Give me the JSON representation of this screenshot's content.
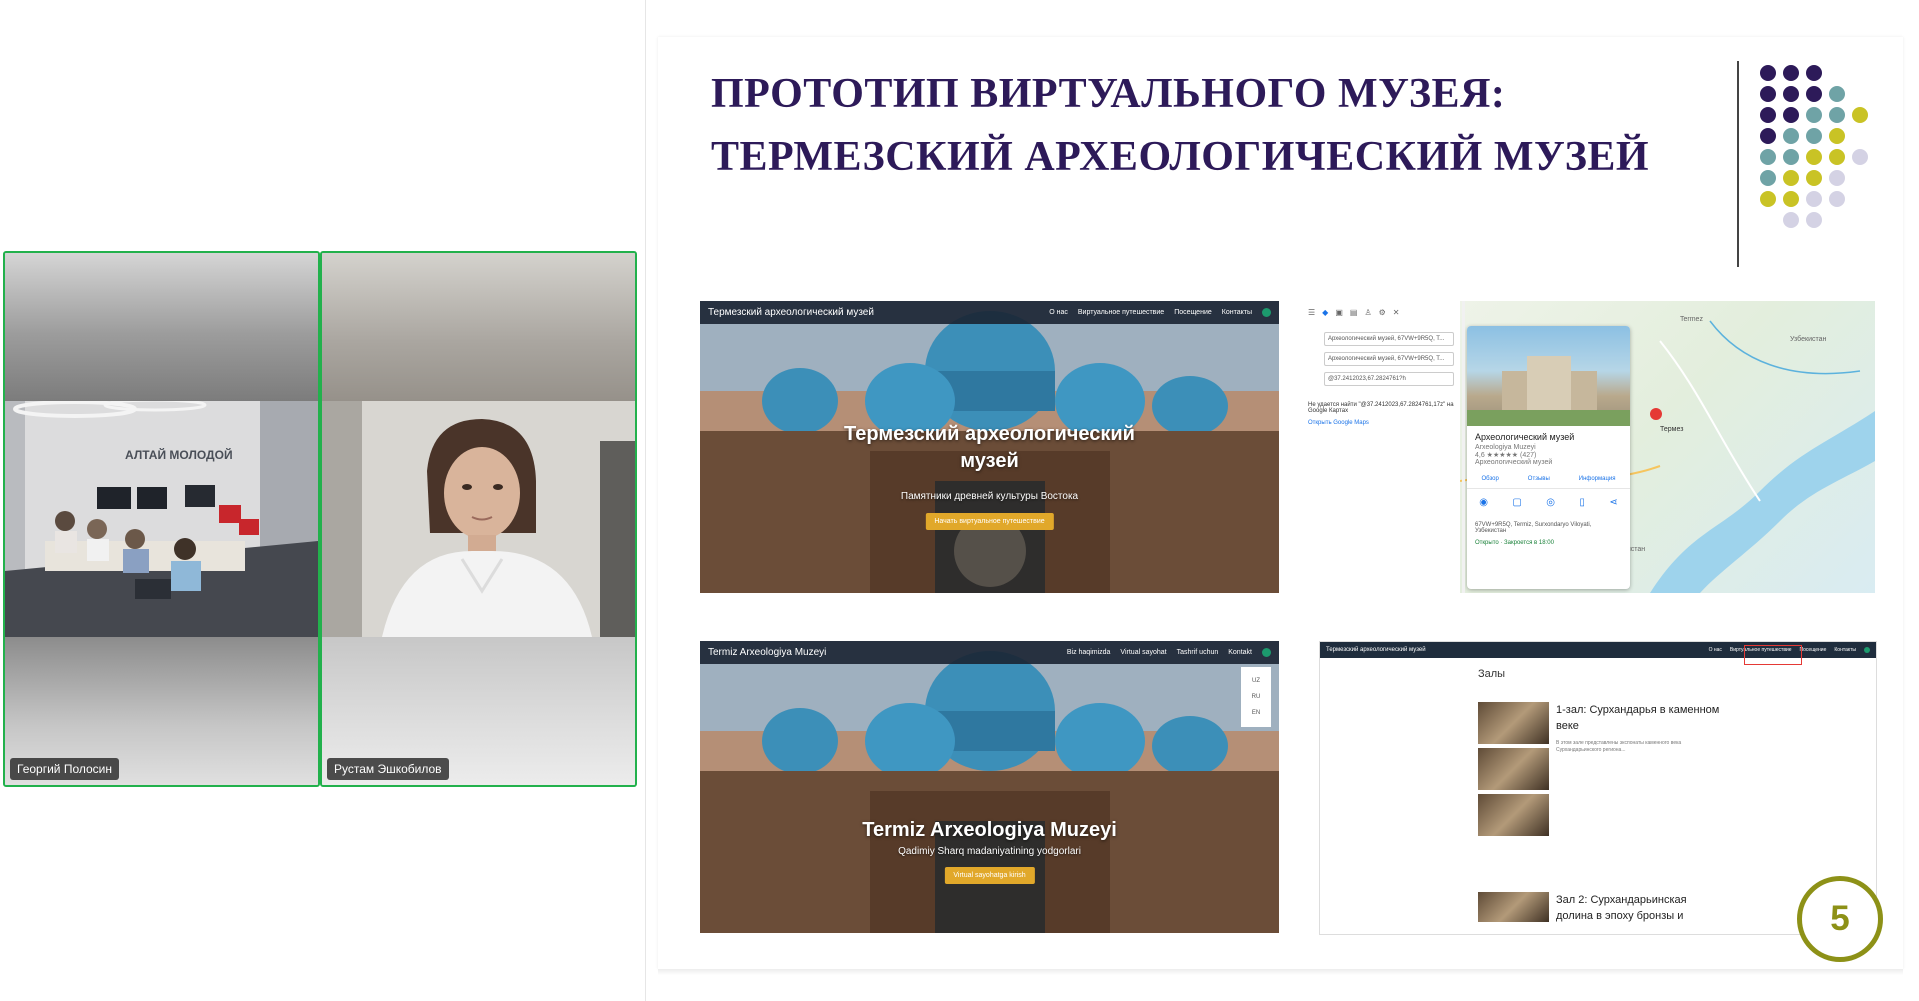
{
  "participants": [
    {
      "name": "Георгий Полосин",
      "video_wall_text": "АЛТАЙ МОЛОДОЙ"
    },
    {
      "name": "Рустам Эшкобилов"
    }
  ],
  "slide": {
    "title_line1": "ПРОТОТИП ВИРТУАЛЬНОГО МУЗЕЯ:",
    "title_line2": "ТЕРМЕЗСКИЙ АРХЕОЛОГИЧЕСКИЙ МУЗЕЙ",
    "page_number": "5",
    "accent_colors": {
      "purple": "#2d1a59",
      "teal": "#6fa3a6",
      "yellow": "#c9c325",
      "lavender": "#d4d2e4",
      "olive": "#8d9117"
    },
    "screenshot_ru": {
      "nav_title": "Термезский археологический музей",
      "nav_links": [
        "О нас",
        "Виртуальное путешествие",
        "Посещение",
        "Контакты"
      ],
      "hero_title_line1": "Термезский археологический",
      "hero_title_line2": "музей",
      "hero_subtitle": "Памятники древней культуры Востока",
      "hero_button": "Начать виртуальное путешествие"
    },
    "screenshot_uz": {
      "nav_title": "Termiz Arxeologiya Muzeyi",
      "nav_links": [
        "Biz haqimizda",
        "Virtual sayohat",
        "Tashrif uchun",
        "Kontakt"
      ],
      "lang_options": [
        "UZ",
        "RU",
        "EN"
      ],
      "hero_title": "Termiz Arxeologiya Muzeyi",
      "hero_subtitle": "Qadimiy Sharq madaniyatining yodgorlari",
      "hero_button": "Virtual sayohatga kirish"
    },
    "screenshot_map": {
      "search_rows": [
        "Археологический музей, 67VW+9R5Q, T...",
        "Археологический музей, 67VW+9R5Q, T...",
        "@37.2412023,67.2824761?h"
      ],
      "notice": "Не удается найти \"@37.2412023,67.2824761,17z\" на Google Картах",
      "link": "Открыть Google Maps",
      "card_title": "Археологический музей",
      "card_subtitle": "Arxeologiya Muzeyi",
      "card_rating": "4,6 ★★★★★ (427)",
      "card_category": "Археологический музей",
      "card_tabs": [
        "Обзор",
        "Отзывы",
        "Информация"
      ],
      "card_address": "67VW+9R5Q, Termiz, Surxondaryo Viloyati, Узбекистан",
      "card_hours": "Открыто · Закроется в 18:00",
      "map_labels": [
        "Termez",
        "Туркменистан",
        "Термез",
        "Узбекистан"
      ]
    },
    "screenshot_halls": {
      "nav_title": "Термезский археологический музей",
      "nav_links": [
        "О нас",
        "Виртуальное путешествие",
        "Посещение",
        "Контакты"
      ],
      "section_title": "Залы",
      "hall1_heading": "1-зал: Сурхандарья в каменном веке",
      "hall1_text": "В этом зале представлены экспонаты каменного века Сурхандарьинского региона...",
      "hall2_heading": "Зал 2: Сурхандарьинская долина в эпоху бронзы и"
    }
  }
}
